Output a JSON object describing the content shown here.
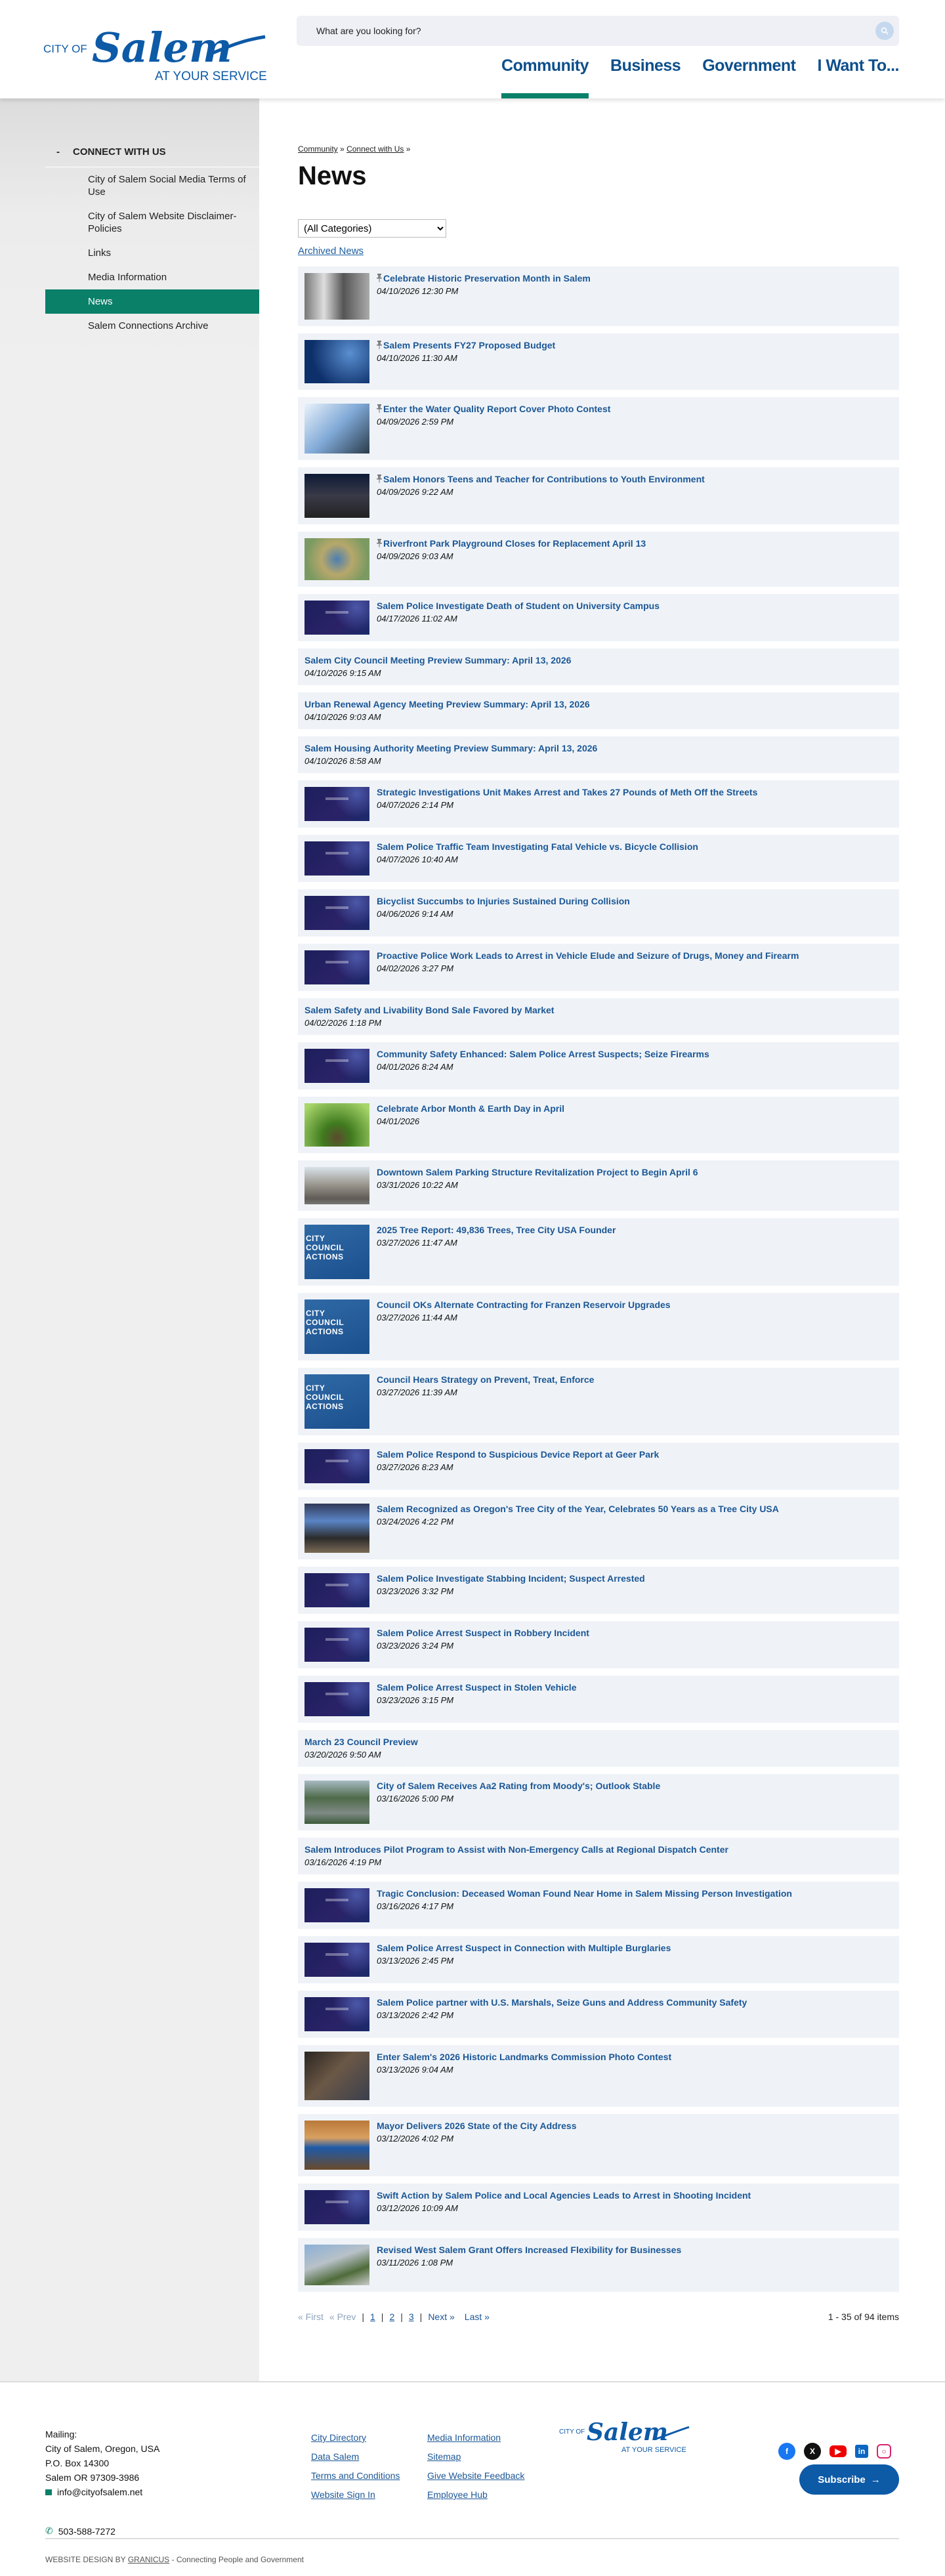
{
  "header": {
    "logo": {
      "top": "CITY OF",
      "script": "Salem",
      "bottom": "AT YOUR SERVICE"
    },
    "search_placeholder": "What are you looking for?",
    "nav": [
      "Community",
      "Business",
      "Government",
      "I Want To..."
    ],
    "active_nav": "Community"
  },
  "sidebar": {
    "heading": "CONNECT WITH US",
    "toggle": "-",
    "items": [
      {
        "label": "City of Salem Social Media Terms of Use"
      },
      {
        "label": "City of Salem Website Disclaimer-Policies"
      },
      {
        "label": "Links"
      },
      {
        "label": "Media Information"
      },
      {
        "label": "News",
        "active": true
      },
      {
        "label": "Salem Connections Archive"
      }
    ]
  },
  "main": {
    "breadcrumb": [
      "Community",
      "Connect with Us"
    ],
    "breadcrumb_sep": "»",
    "title": "News",
    "category_select": "(All Categories)",
    "archived_link": "Archived News",
    "items": [
      {
        "title": "Celebrate Historic Preservation Month in Salem",
        "date": "04/10/2026 12:30 PM",
        "pinned": true,
        "thumb": "historic"
      },
      {
        "title": "Salem Presents FY27 Proposed Budget",
        "date": "04/10/2026 11:30 AM",
        "pinned": true,
        "thumb": "budget"
      },
      {
        "title": "Enter the Water Quality Report Cover Photo Contest",
        "date": "04/09/2026 2:59 PM",
        "pinned": true,
        "thumb": "water"
      },
      {
        "title": "Salem Honors Teens and Teacher for Contributions to Youth Environment",
        "date": "04/09/2026 9:22 AM",
        "pinned": true,
        "thumb": "teens"
      },
      {
        "title": "Riverfront Park Playground Closes for Replacement April 13",
        "date": "04/09/2026 9:03 AM",
        "pinned": true,
        "thumb": "park"
      },
      {
        "title": "Salem Police Investigate Death of Student on University Campus",
        "date": "04/17/2026 11:02 AM",
        "thumb": "police"
      },
      {
        "title": "Salem City Council Meeting Preview Summary: April 13, 2026",
        "date": "04/10/2026 9:15 AM"
      },
      {
        "title": "Urban Renewal Agency Meeting Preview Summary: April 13, 2026",
        "date": "04/10/2026 9:03 AM"
      },
      {
        "title": "Salem Housing Authority Meeting Preview Summary: April 13, 2026",
        "date": "04/10/2026 8:58 AM"
      },
      {
        "title": "Strategic Investigations Unit Makes Arrest and Takes 27 Pounds of Meth Off the Streets",
        "date": "04/07/2026 2:14 PM",
        "thumb": "police"
      },
      {
        "title": "Salem Police Traffic Team Investigating Fatal Vehicle vs. Bicycle Collision",
        "date": "04/07/2026 10:40 AM",
        "thumb": "police"
      },
      {
        "title": "Bicyclist Succumbs to Injuries Sustained During Collision",
        "date": "04/06/2026 9:14 AM",
        "thumb": "police"
      },
      {
        "title": "Proactive Police Work Leads to Arrest in Vehicle Elude and Seizure of Drugs, Money and Firearm",
        "date": "04/02/2026 3:27 PM",
        "thumb": "police"
      },
      {
        "title": "Salem Safety and Livability Bond Sale Favored by Market",
        "date": "04/02/2026 1:18 PM"
      },
      {
        "title": "Community Safety Enhanced: Salem Police Arrest Suspects; Seize Firearms",
        "date": "04/01/2026 8:24 AM",
        "thumb": "police"
      },
      {
        "title": "Celebrate Arbor Month & Earth Day in April",
        "date": "04/01/2026",
        "thumb": "tree"
      },
      {
        "title": "Downtown Salem Parking Structure Revitalization Project to Begin April 6",
        "date": "03/31/2026 10:22 AM",
        "thumb": "parking"
      },
      {
        "title": "2025 Tree Report: 49,836 Trees, Tree City USA Founder",
        "date": "03/27/2026 11:47 AM",
        "thumb": "council"
      },
      {
        "title": "Council OKs Alternate Contracting for Franzen Reservoir Upgrades",
        "date": "03/27/2026 11:44 AM",
        "thumb": "council"
      },
      {
        "title": "Council Hears Strategy on Prevent, Treat, Enforce",
        "date": "03/27/2026 11:39 AM",
        "thumb": "council"
      },
      {
        "title": "Salem Police Respond to Suspicious Device Report at Geer Park",
        "date": "03/27/2026 8:23 AM",
        "thumb": "police"
      },
      {
        "title": "Salem Recognized as Oregon's Tree City of the Year, Celebrates 50 Years as a Tree City USA",
        "date": "03/24/2026 4:22 PM",
        "thumb": "award"
      },
      {
        "title": "Salem Police Investigate Stabbing Incident; Suspect Arrested",
        "date": "03/23/2026 3:32 PM",
        "thumb": "police"
      },
      {
        "title": "Salem Police Arrest Suspect in Robbery Incident",
        "date": "03/23/2026 3:24 PM",
        "thumb": "police"
      },
      {
        "title": "Salem Police Arrest Suspect in Stolen Vehicle",
        "date": "03/23/2026 3:15 PM",
        "thumb": "police"
      },
      {
        "title": "March 23 Council Preview",
        "date": "03/20/2026 9:50 AM"
      },
      {
        "title": "City of Salem Receives Aa2 Rating from Moody's; Outlook Stable",
        "date": "03/16/2026 5:00 PM",
        "thumb": "aerial"
      },
      {
        "title": "Salem Introduces Pilot Program to Assist with Non-Emergency Calls at Regional Dispatch Center",
        "date": "03/16/2026 4:19 PM"
      },
      {
        "title": "Tragic Conclusion: Deceased Woman Found Near Home in Salem Missing Person Investigation",
        "date": "03/16/2026 4:17 PM",
        "thumb": "police"
      },
      {
        "title": "Salem Police Arrest Suspect in Connection with Multiple Burglaries",
        "date": "03/13/2026 2:45 PM",
        "thumb": "police"
      },
      {
        "title": "Salem Police partner with U.S. Marshals, Seize Guns and Address Community Safety",
        "date": "03/13/2026 2:42 PM",
        "thumb": "police"
      },
      {
        "title": "Enter Salem's 2026 Historic Landmarks Commission Photo Contest",
        "date": "03/13/2026 9:04 AM",
        "thumb": "landmark"
      },
      {
        "title": "Mayor Delivers 2026 State of the City Address",
        "date": "03/12/2026 4:02 PM",
        "thumb": "mayor"
      },
      {
        "title": "Swift Action by Salem Police and Local Agencies Leads to Arrest in Shooting Incident",
        "date": "03/12/2026 10:09 AM",
        "thumb": "police"
      },
      {
        "title": "Revised West Salem Grant Offers Increased Flexibility for Businesses",
        "date": "03/11/2026 1:08 PM",
        "thumb": "street"
      }
    ],
    "council_thumb_text": "CITY COUNCIL ACTIONS",
    "pagination": {
      "first": "« First",
      "prev": "« Prev",
      "pages": [
        "1",
        "2",
        "3"
      ],
      "current": "1",
      "next": "Next »",
      "last": "Last »",
      "summary": "1 - 35 of 94 items"
    }
  },
  "footer": {
    "mailing_label": "Mailing:",
    "address": [
      "City of Salem, Oregon, USA",
      "P.O. Box 14300",
      "Salem OR 97309-3986"
    ],
    "email": "info@cityofsalem.net",
    "phone": "503-588-7272",
    "links": [
      "City Directory",
      "Media Information",
      "Data Salem",
      "Sitemap",
      "Terms and Conditions",
      "Give Website Feedback",
      "Website Sign In",
      "Employee Hub"
    ],
    "social": [
      "facebook-icon",
      "x-icon",
      "youtube-icon",
      "linkedin-icon",
      "instagram-icon"
    ],
    "subscribe": "Subscribe",
    "credit_prefix": "WEBSITE DESIGN BY",
    "credit_brand": "GRANICUS",
    "credit_suffix": "- Connecting People and Government"
  },
  "colors": {
    "brand_blue": "#0d4f8b",
    "link_blue": "#1c5796",
    "green": "#0a8069",
    "card_bg": "#eff3f7"
  }
}
